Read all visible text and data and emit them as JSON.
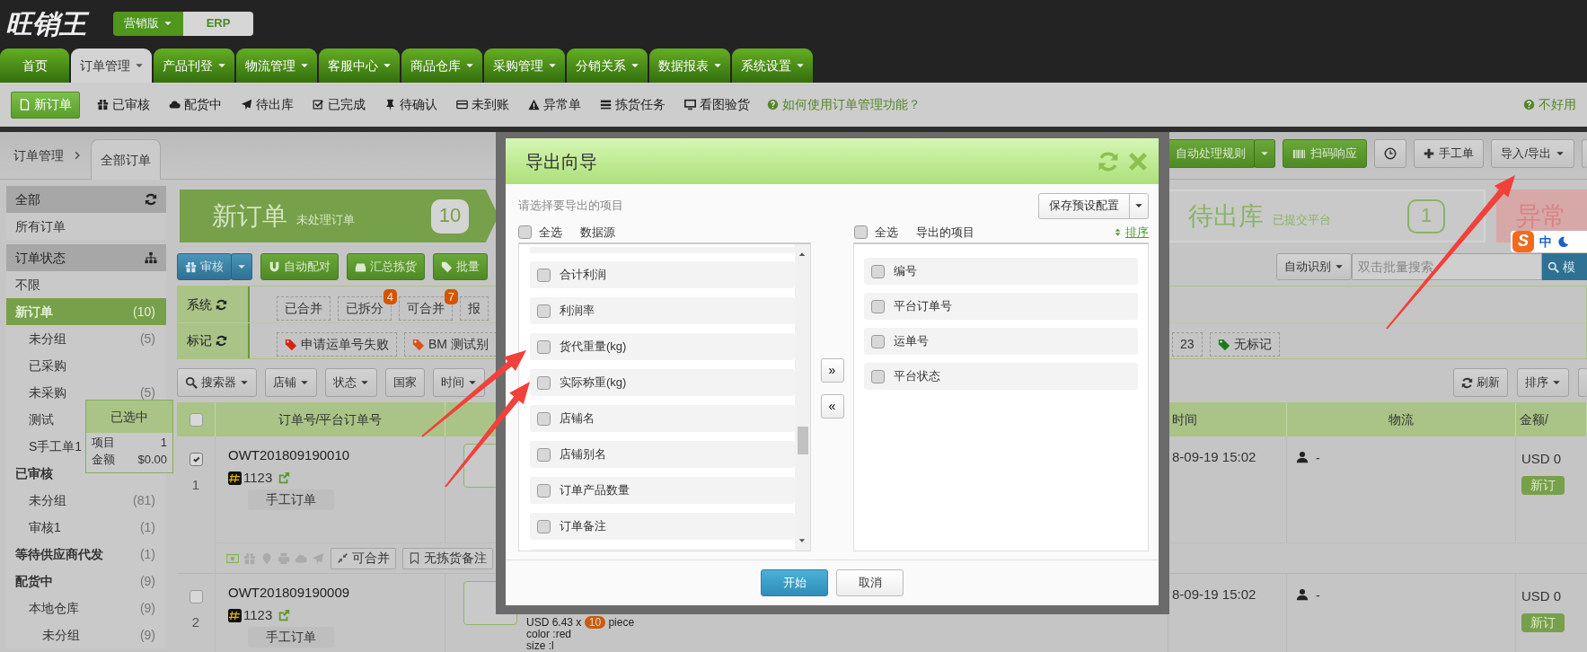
{
  "top_bar": {
    "logo": "旺销王",
    "edition_switch": [
      {
        "label": "营销版",
        "selected": true,
        "has_menu": true
      },
      {
        "label": "ERP",
        "selected": false,
        "has_menu": false
      }
    ]
  },
  "main_tabs": [
    {
      "label": "首页",
      "selected": false,
      "has_menu": false
    },
    {
      "label": "订单管理",
      "selected": true,
      "has_menu": true
    },
    {
      "label": "产品刊登",
      "selected": false,
      "has_menu": true
    },
    {
      "label": "物流管理",
      "selected": false,
      "has_menu": true
    },
    {
      "label": "客服中心",
      "selected": false,
      "has_menu": true
    },
    {
      "label": "商品仓库",
      "selected": false,
      "has_menu": true
    },
    {
      "label": "采购管理",
      "selected": false,
      "has_menu": true
    },
    {
      "label": "分销关系",
      "selected": false,
      "has_menu": true
    },
    {
      "label": "数据报表",
      "selected": false,
      "has_menu": true
    },
    {
      "label": "系统设置",
      "selected": false,
      "has_menu": true
    }
  ],
  "sub_nav": {
    "items": [
      {
        "label": "新订单",
        "selected": true
      },
      {
        "label": "已审核",
        "selected": false
      },
      {
        "label": "配货中",
        "selected": false
      },
      {
        "label": "待出库",
        "selected": false
      },
      {
        "label": "已完成",
        "selected": false
      },
      {
        "label": "待确认",
        "selected": false
      },
      {
        "label": "未到账",
        "selected": false
      },
      {
        "label": "异常单",
        "selected": false
      },
      {
        "label": "拣货任务",
        "selected": false
      },
      {
        "label": "看图验货",
        "selected": false
      }
    ],
    "help_link": "如何使用订单管理功能？",
    "feedback_link": "不好用"
  },
  "breadcrumb": {
    "parent": "订单管理",
    "current_tab": "全部订单"
  },
  "toolbar": {
    "auto_rules": "自动处理规则",
    "scan": "扫码响应",
    "manual_order": "手工单",
    "import_export": "导入/导出"
  },
  "sidebar": {
    "sections": [
      {
        "title": "全部",
        "items": [
          {
            "label": "所有订单",
            "bold": false,
            "selected": false
          }
        ]
      },
      {
        "title": "订单状态",
        "items": [
          {
            "label": "不限",
            "bold": false,
            "selected": false
          },
          {
            "label": "新订单",
            "count": "(10)",
            "bold": true,
            "selected": true,
            "children": [
              {
                "label": "未分组",
                "count": "(5)",
                "selected": false
              },
              {
                "label": "已采购",
                "selected": false
              },
              {
                "label": "未采购",
                "count": "(5)",
                "selected": false
              },
              {
                "label": "测试",
                "selected": false
              },
              {
                "label": "S手工单1",
                "selected": false
              }
            ]
          },
          {
            "label": "已审核",
            "bold": true,
            "selected": false,
            "children": [
              {
                "label": "未分组",
                "count": "(81)",
                "selected": false
              },
              {
                "label": "审核1",
                "count": "(1)",
                "selected": false
              }
            ]
          },
          {
            "label": "等待供应商代发",
            "count": "(1)",
            "bold": true,
            "selected": false
          },
          {
            "label": "配货中",
            "count": "(9)",
            "bold": true,
            "selected": false,
            "children": [
              {
                "label": "本地仓库",
                "count": "(9)",
                "selected": false,
                "children": [
                  {
                    "label": "未分组",
                    "count": "(9)",
                    "selected": false
                  }
                ]
              }
            ]
          }
        ]
      }
    ]
  },
  "selection_popup": {
    "title": "已选中",
    "rows": [
      {
        "label": "项目",
        "value": "1"
      },
      {
        "label": "金额",
        "value": "$0.00"
      }
    ]
  },
  "status_cards": [
    {
      "title": "新订单",
      "subtitle": "未处理订单",
      "count": "10",
      "kind": "active"
    },
    {
      "title": "待出库",
      "subtitle": "已提交平台",
      "count": "1",
      "kind": "normal"
    },
    {
      "title": "异常",
      "kind": "alert"
    }
  ],
  "actions": [
    {
      "label": "审核",
      "kind": "split"
    },
    {
      "label": "自动配对",
      "kind": "plain"
    },
    {
      "label": "汇总拣货",
      "kind": "plain"
    },
    {
      "label": "批量",
      "kind": "plain"
    }
  ],
  "search": {
    "mode": "自动识别",
    "placeholder": "双击批量搜索",
    "button": "模"
  },
  "filters": [
    {
      "label": "系统",
      "tags": [
        {
          "label": "已合并"
        },
        {
          "label": "已拆分",
          "badge": "4"
        },
        {
          "label": "可合并",
          "badge": "7"
        },
        {
          "label": "报"
        }
      ]
    },
    {
      "label": "标记",
      "tags": [
        {
          "label": "申请运单号失败",
          "color": "#d9230f"
        },
        {
          "label": "BM 测试别",
          "color": "#d9531e"
        }
      ],
      "tags_past_dialog": [
        {
          "label": "23"
        },
        {
          "label": "无标记",
          "color": "#1e7a1e"
        }
      ]
    }
  ],
  "filter_buttons": [
    {
      "label": "搜索器",
      "has_menu": true
    },
    {
      "label": "店铺",
      "has_menu": true
    },
    {
      "label": "状态",
      "has_menu": true
    },
    {
      "label": "国家",
      "has_menu": false
    },
    {
      "label": "时间",
      "has_menu": true
    }
  ],
  "list_tools": [
    {
      "label": "刷新",
      "has_menu": false
    },
    {
      "label": "排序",
      "has_menu": true
    }
  ],
  "table": {
    "select_all": false,
    "columns": [
      "订单号/平台订单号",
      "时间",
      "物流",
      "金额/"
    ],
    "rows": [
      {
        "index": "1",
        "selected": true,
        "order_no": "OWT201809190010",
        "platform_no": "1123",
        "source": "手工订单",
        "time": "8-09-19 15:02",
        "logistics": "-",
        "amount": "USD 0",
        "status": "新订",
        "actions": [
          "可合并",
          "无拣货备注"
        ]
      },
      {
        "index": "2",
        "selected": false,
        "order_no": "OWT201809190009",
        "platform_no": "1123",
        "source": "手工订单",
        "product": {
          "price": "USD 6.43 x",
          "quantity": "10",
          "unit": "piece",
          "attributes": [
            "color :red",
            "size :l"
          ]
        },
        "time": "8-09-19 15:02",
        "logistics": "-",
        "amount": "USD 0",
        "status": "新订"
      }
    ]
  },
  "dialog": {
    "title": "导出向导",
    "hint": "请选择要导出的项目",
    "preset_button": "保存预设配置",
    "source": {
      "select_all": "全选",
      "select_all_checked": false,
      "title": "数据源",
      "items": [
        {
          "label": "合计利润",
          "checked": false
        },
        {
          "label": "利润率",
          "checked": false
        },
        {
          "label": "货代重量(kg)",
          "checked": false
        },
        {
          "label": "实际称重(kg)",
          "checked": false
        },
        {
          "label": "店铺名",
          "checked": false
        },
        {
          "label": "店铺别名",
          "checked": false
        },
        {
          "label": "订单产品数量",
          "checked": false
        },
        {
          "label": "订单备注",
          "checked": false
        }
      ]
    },
    "target": {
      "select_all": "全选",
      "select_all_checked": false,
      "title": "导出的项目",
      "sort": "排序",
      "items": [
        {
          "label": "编号",
          "checked": false
        },
        {
          "label": "平台订单号",
          "checked": false
        },
        {
          "label": "运单号",
          "checked": false
        },
        {
          "label": "平台状态",
          "checked": false
        }
      ]
    },
    "move_right": "»",
    "move_left": "«",
    "buttons": [
      {
        "label": "开始",
        "kind": "primary"
      },
      {
        "label": "取消",
        "kind": "default"
      }
    ]
  },
  "ime": {
    "logo": "S",
    "mode": "中"
  }
}
